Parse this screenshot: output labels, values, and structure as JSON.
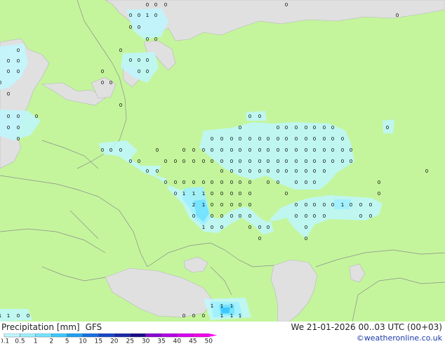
{
  "map": {
    "cells": [
      [
        "0",
        186,
        21
      ],
      [
        "0",
        198,
        21
      ],
      [
        "1",
        210,
        21
      ],
      [
        "0",
        222,
        21
      ],
      [
        "0",
        186,
        38
      ],
      [
        "0",
        198,
        38
      ],
      [
        "0",
        210,
        55
      ],
      [
        "0",
        222,
        55
      ],
      [
        "0",
        172,
        71
      ],
      [
        "0",
        186,
        85
      ],
      [
        "0",
        198,
        85
      ],
      [
        "0",
        210,
        85
      ],
      [
        "0",
        198,
        101
      ],
      [
        "0",
        210,
        101
      ],
      [
        "0",
        146,
        101
      ],
      [
        "0",
        146,
        117
      ],
      [
        "0",
        158,
        117
      ],
      [
        "0",
        172,
        149
      ],
      [
        "0",
        26,
        71
      ],
      [
        "0",
        12,
        86
      ],
      [
        "0",
        26,
        86
      ],
      [
        "0",
        12,
        101
      ],
      [
        "0",
        26,
        101
      ],
      [
        "0",
        0,
        117
      ],
      [
        "0",
        12,
        133
      ],
      [
        "0",
        12,
        165
      ],
      [
        "0",
        26,
        165
      ],
      [
        "0",
        52,
        165
      ],
      [
        "0",
        12,
        181
      ],
      [
        "0",
        26,
        181
      ],
      [
        "0",
        26,
        197
      ],
      [
        "0",
        210,
        6
      ],
      [
        "0",
        222,
        6
      ],
      [
        "0",
        236,
        6
      ],
      [
        "0",
        408,
        6
      ],
      [
        "0",
        566,
        21
      ],
      [
        "0",
        356,
        165
      ],
      [
        "0",
        370,
        165
      ],
      [
        "0",
        342,
        181
      ],
      [
        "0",
        396,
        181
      ],
      [
        "0",
        408,
        181
      ],
      [
        "0",
        422,
        181
      ],
      [
        "0",
        436,
        181
      ],
      [
        "0",
        448,
        181
      ],
      [
        "0",
        462,
        181
      ],
      [
        "0",
        474,
        181
      ],
      [
        "0",
        552,
        181
      ],
      [
        "0",
        302,
        197
      ],
      [
        "0",
        316,
        197
      ],
      [
        "0",
        330,
        197
      ],
      [
        "0",
        342,
        197
      ],
      [
        "0",
        356,
        197
      ],
      [
        "0",
        370,
        197
      ],
      [
        "0",
        382,
        197
      ],
      [
        "0",
        396,
        197
      ],
      [
        "0",
        408,
        197
      ],
      [
        "0",
        422,
        197
      ],
      [
        "0",
        436,
        197
      ],
      [
        "0",
        448,
        197
      ],
      [
        "0",
        462,
        197
      ],
      [
        "0",
        474,
        197
      ],
      [
        "0",
        488,
        197
      ],
      [
        "0",
        146,
        213
      ],
      [
        "0",
        158,
        213
      ],
      [
        "0",
        172,
        213
      ],
      [
        "0",
        224,
        213
      ],
      [
        "0",
        262,
        213
      ],
      [
        "0",
        276,
        213
      ],
      [
        "0",
        290,
        213
      ],
      [
        "0",
        302,
        213
      ],
      [
        "0",
        316,
        213
      ],
      [
        "0",
        330,
        213
      ],
      [
        "0",
        342,
        213
      ],
      [
        "0",
        356,
        213
      ],
      [
        "0",
        370,
        213
      ],
      [
        "0",
        382,
        213
      ],
      [
        "0",
        396,
        213
      ],
      [
        "0",
        408,
        213
      ],
      [
        "0",
        422,
        213
      ],
      [
        "0",
        436,
        213
      ],
      [
        "0",
        448,
        213
      ],
      [
        "0",
        462,
        213
      ],
      [
        "0",
        474,
        213
      ],
      [
        "0",
        488,
        213
      ],
      [
        "0",
        500,
        213
      ],
      [
        "0",
        186,
        229
      ],
      [
        "0",
        198,
        229
      ],
      [
        "0",
        236,
        229
      ],
      [
        "0",
        250,
        229
      ],
      [
        "0",
        262,
        229
      ],
      [
        "0",
        276,
        229
      ],
      [
        "0",
        290,
        229
      ],
      [
        "0",
        302,
        229
      ],
      [
        "0",
        316,
        229
      ],
      [
        "0",
        330,
        229
      ],
      [
        "0",
        342,
        229
      ],
      [
        "0",
        356,
        229
      ],
      [
        "0",
        370,
        229
      ],
      [
        "0",
        382,
        229
      ],
      [
        "0",
        396,
        229
      ],
      [
        "0",
        408,
        229
      ],
      [
        "0",
        422,
        229
      ],
      [
        "0",
        436,
        229
      ],
      [
        "0",
        448,
        229
      ],
      [
        "0",
        462,
        229
      ],
      [
        "0",
        474,
        229
      ],
      [
        "0",
        488,
        229
      ],
      [
        "0",
        500,
        229
      ],
      [
        "0",
        210,
        243
      ],
      [
        "0",
        224,
        243
      ],
      [
        "0",
        316,
        243
      ],
      [
        "0",
        330,
        243
      ],
      [
        "0",
        342,
        243
      ],
      [
        "0",
        356,
        243
      ],
      [
        "0",
        370,
        243
      ],
      [
        "0",
        382,
        243
      ],
      [
        "0",
        396,
        243
      ],
      [
        "0",
        408,
        243
      ],
      [
        "0",
        422,
        243
      ],
      [
        "0",
        436,
        243
      ],
      [
        "0",
        448,
        243
      ],
      [
        "0",
        462,
        243
      ],
      [
        "0",
        608,
        243
      ],
      [
        "0",
        236,
        259
      ],
      [
        "0",
        250,
        259
      ],
      [
        "0",
        262,
        259
      ],
      [
        "0",
        276,
        259
      ],
      [
        "0",
        290,
        259
      ],
      [
        "0",
        302,
        259
      ],
      [
        "0",
        316,
        259
      ],
      [
        "0",
        330,
        259
      ],
      [
        "0",
        342,
        259
      ],
      [
        "0",
        356,
        259
      ],
      [
        "0",
        382,
        259
      ],
      [
        "0",
        396,
        259
      ],
      [
        "0",
        422,
        259
      ],
      [
        "0",
        436,
        259
      ],
      [
        "0",
        448,
        259
      ],
      [
        "0",
        540,
        259
      ],
      [
        "0",
        250,
        275
      ],
      [
        "1",
        262,
        275
      ],
      [
        "1",
        276,
        275
      ],
      [
        "1",
        290,
        275
      ],
      [
        "0",
        302,
        275
      ],
      [
        "0",
        316,
        275
      ],
      [
        "0",
        330,
        275
      ],
      [
        "0",
        342,
        275
      ],
      [
        "0",
        356,
        275
      ],
      [
        "0",
        408,
        275
      ],
      [
        "0",
        540,
        275
      ],
      [
        "2",
        276,
        291
      ],
      [
        "1",
        290,
        291
      ],
      [
        "0",
        302,
        291
      ],
      [
        "0",
        316,
        291
      ],
      [
        "0",
        330,
        291
      ],
      [
        "0",
        342,
        291
      ],
      [
        "0",
        356,
        291
      ],
      [
        "0",
        422,
        291
      ],
      [
        "0",
        436,
        291
      ],
      [
        "0",
        448,
        291
      ],
      [
        "0",
        462,
        291
      ],
      [
        "0",
        474,
        291
      ],
      [
        "1",
        488,
        291
      ],
      [
        "0",
        500,
        291
      ],
      [
        "0",
        514,
        291
      ],
      [
        "0",
        528,
        291
      ],
      [
        "0",
        276,
        307
      ],
      [
        "0",
        302,
        307
      ],
      [
        "0",
        316,
        307
      ],
      [
        "0",
        330,
        307
      ],
      [
        "0",
        342,
        307
      ],
      [
        "0",
        356,
        307
      ],
      [
        "0",
        422,
        307
      ],
      [
        "0",
        436,
        307
      ],
      [
        "0",
        448,
        307
      ],
      [
        "0",
        462,
        307
      ],
      [
        "0",
        514,
        307
      ],
      [
        "0",
        528,
        307
      ],
      [
        "1",
        290,
        323
      ],
      [
        "0",
        302,
        323
      ],
      [
        "0",
        316,
        323
      ],
      [
        "0",
        356,
        323
      ],
      [
        "0",
        370,
        323
      ],
      [
        "0",
        382,
        323
      ],
      [
        "0",
        436,
        323
      ],
      [
        "0",
        436,
        339
      ],
      [
        "0",
        370,
        339
      ],
      [
        "0",
        262,
        449
      ],
      [
        "0",
        276,
        449
      ],
      [
        "0",
        290,
        449
      ],
      [
        "1",
        302,
        435
      ],
      [
        "1",
        316,
        435
      ],
      [
        "1",
        330,
        435
      ],
      [
        "1",
        316,
        449
      ],
      [
        "1",
        330,
        449
      ],
      [
        "1",
        342,
        449
      ],
      [
        "1",
        0,
        449
      ],
      [
        "1",
        12,
        449
      ],
      [
        "0",
        26,
        449
      ],
      [
        "0",
        40,
        449
      ]
    ]
  },
  "legend": {
    "title": "Precipitation [mm]",
    "model": "GFS",
    "ticks": [
      "0.1",
      "0.5",
      "1",
      "2",
      "5",
      "10",
      "15",
      "20",
      "25",
      "30",
      "35",
      "40",
      "45",
      "50"
    ],
    "colors": [
      "#ffffff",
      "#bff7ff",
      "#9eefff",
      "#76e3ff",
      "#3cc9ff",
      "#1ea0f0",
      "#1670e0",
      "#1846c8",
      "#1a28a8",
      "#180c88",
      "#8800d0",
      "#b400e6",
      "#d800f0",
      "#f000e8",
      "#ff00ff"
    ]
  },
  "run_info": "We 21-01-2026 00..03 UTC (00+03)",
  "credit": "©weatheronline.co.uk"
}
